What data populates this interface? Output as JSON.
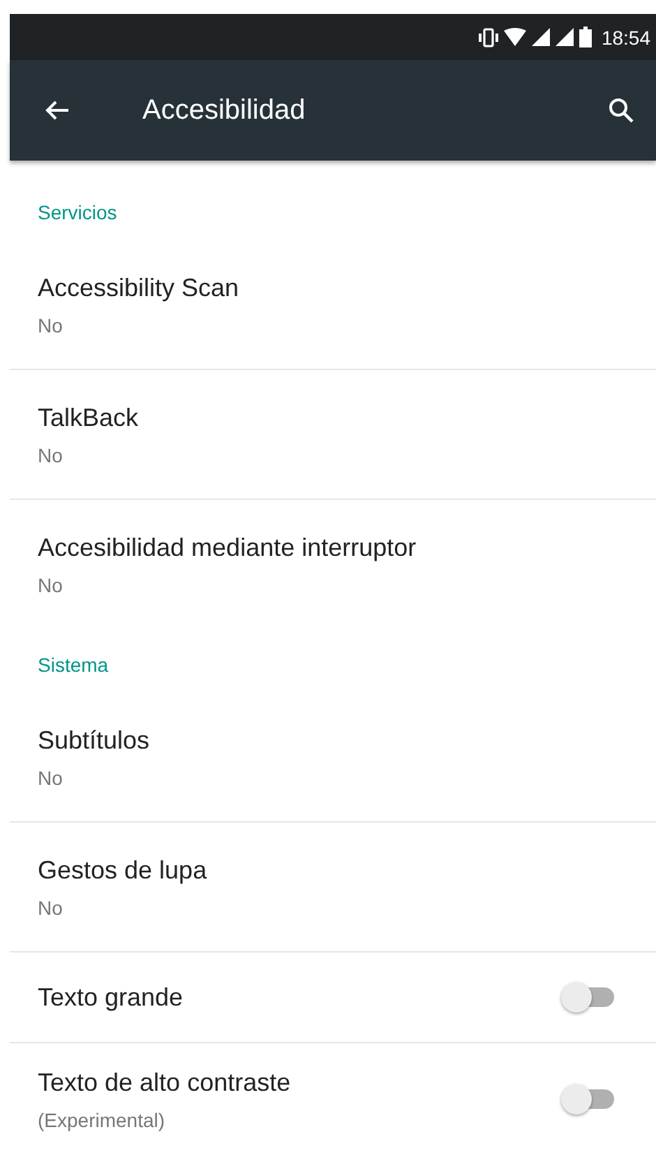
{
  "status_bar": {
    "time": "18:54"
  },
  "toolbar": {
    "title": "Accesibilidad"
  },
  "items": [
    {
      "kind": "header",
      "title": "Servicios"
    },
    {
      "kind": "item",
      "title": "Accessibility Scan",
      "summary": "No"
    },
    {
      "kind": "item",
      "title": "TalkBack",
      "summary": "No"
    },
    {
      "kind": "item",
      "title": "Accesibilidad mediante interruptor",
      "summary": "No"
    },
    {
      "kind": "header",
      "title": "Sistema"
    },
    {
      "kind": "item",
      "title": "Subtítulos",
      "summary": "No"
    },
    {
      "kind": "item",
      "title": "Gestos de lupa",
      "summary": "No"
    },
    {
      "kind": "switch",
      "title": "Texto grande",
      "on": false
    },
    {
      "kind": "switch",
      "title": "Texto de alto contraste",
      "summary": "(Experimental)",
      "on": false
    }
  ]
}
